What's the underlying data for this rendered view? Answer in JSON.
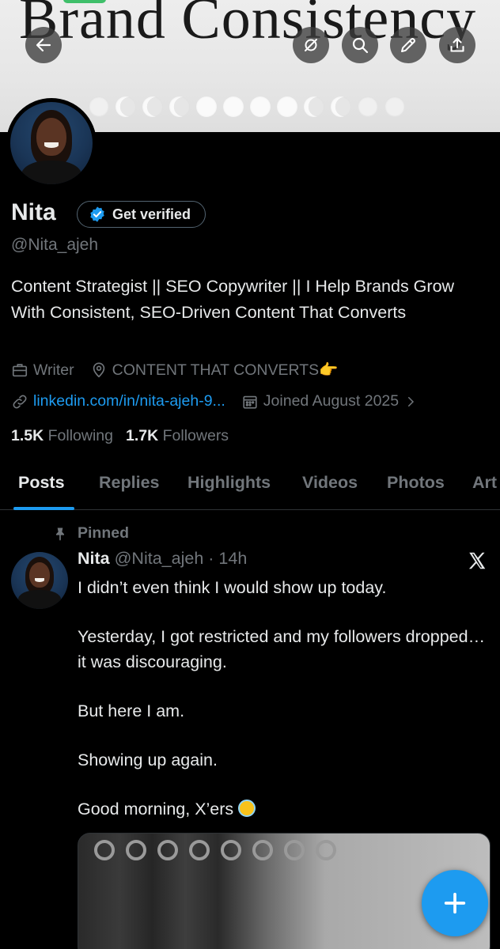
{
  "banner": {
    "title": "Brand Consistency"
  },
  "profile": {
    "name": "Nita",
    "verify_label": "Get verified",
    "handle": "@Nita_ajeh",
    "bio": "Content Strategist || SEO Copywriter || I Help Brands Grow With Consistent, SEO-Driven Content That Converts",
    "profession": "Writer",
    "location": "CONTENT THAT CONVERTS👉",
    "link": "linkedin.com/in/nita-ajeh-9...",
    "joined": "Joined August 2025",
    "following_count": "1.5K",
    "following_label": "Following",
    "followers_count": "1.7K",
    "followers_label": "Followers"
  },
  "tabs": [
    {
      "label": "Posts"
    },
    {
      "label": "Replies"
    },
    {
      "label": "Highlights"
    },
    {
      "label": "Videos"
    },
    {
      "label": "Photos"
    },
    {
      "label": "Art"
    }
  ],
  "post": {
    "pinned_label": "Pinned",
    "author_name": "Nita",
    "author_handle": "@Nita_ajeh",
    "separator": "·",
    "time": "14h",
    "paragraphs": [
      "I didn’t even think I would show up today.",
      "Yesterday, I got restricted and my followers dropped… it was discouraging.",
      "But here I am.",
      "Showing up again.",
      "Good morning, X’ers"
    ]
  },
  "colors": {
    "accent": "#1d9bf0",
    "background": "#000000",
    "muted": "#71767b",
    "text": "#e7e9ea"
  },
  "icons": {
    "back": "arrow-left-icon",
    "mute": "no-bell-icon",
    "search": "search-icon",
    "edit": "pencil-icon",
    "share": "share-icon",
    "verified": "verified-badge-icon",
    "profession": "briefcase-icon",
    "location": "location-pin-icon",
    "link": "link-icon",
    "calendar": "calendar-icon",
    "pinned": "pin-icon",
    "x_logo": "x-logo-icon",
    "compose": "plus-icon"
  }
}
